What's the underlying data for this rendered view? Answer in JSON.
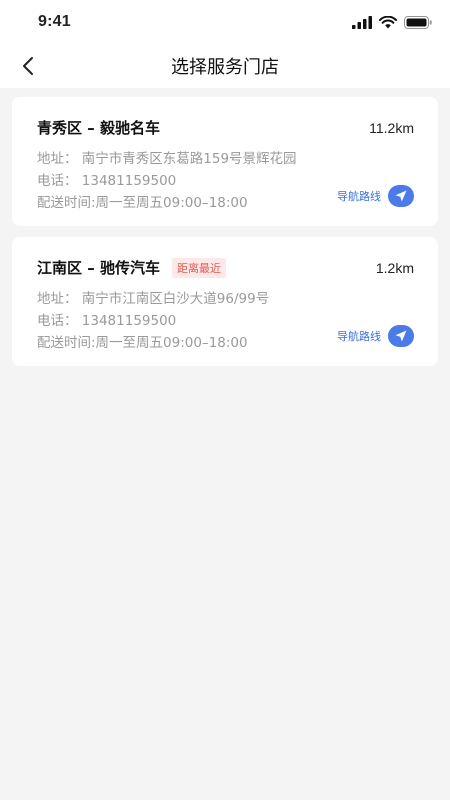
{
  "status_bar": {
    "time": "9:41",
    "icons": [
      "signal-icon",
      "wifi-icon",
      "battery-icon"
    ]
  },
  "header": {
    "back_icon": "chevron-left-icon",
    "title": "选择服务门店"
  },
  "stores": [
    {
      "name": "青秀区 – 毅驰名车",
      "tag": "",
      "distance": "11.2km",
      "address": "地址：  南宁市青秀区东葛路159号景辉花园",
      "phone": "电话：  13481159500",
      "hours": "配送时间:周一至周五09:00–18:00",
      "nav_label": "导航路线",
      "nav_icon": "navigation-arrow-icon"
    },
    {
      "name": "江南区 – 驰传汽车",
      "tag": "距离最近",
      "distance": "1.2km",
      "address": "地址：  南宁市江南区白沙大道96/99号",
      "phone": "电话：  13481159500",
      "hours": "配送时间:周一至周五09:00–18:00",
      "nav_label": "导航路线",
      "nav_icon": "navigation-arrow-icon"
    }
  ],
  "colors": {
    "accent": "#4a7be8",
    "tag_bg": "#fde9e8",
    "tag_text": "#e15b52",
    "page_bg": "#f4f4f4"
  }
}
